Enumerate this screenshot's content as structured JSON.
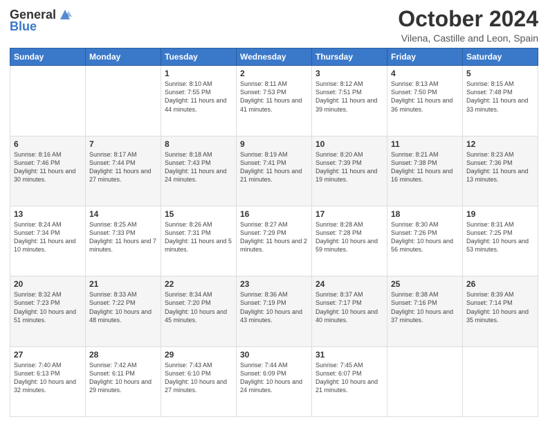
{
  "header": {
    "logo": {
      "general": "General",
      "blue": "Blue"
    },
    "title": "October 2024",
    "subtitle": "Vilena, Castille and Leon, Spain"
  },
  "calendar": {
    "days_of_week": [
      "Sunday",
      "Monday",
      "Tuesday",
      "Wednesday",
      "Thursday",
      "Friday",
      "Saturday"
    ],
    "weeks": [
      {
        "alt": false,
        "days": [
          {
            "num": "",
            "info": ""
          },
          {
            "num": "",
            "info": ""
          },
          {
            "num": "1",
            "info": "Sunrise: 8:10 AM\nSunset: 7:55 PM\nDaylight: 11 hours and 44 minutes."
          },
          {
            "num": "2",
            "info": "Sunrise: 8:11 AM\nSunset: 7:53 PM\nDaylight: 11 hours and 41 minutes."
          },
          {
            "num": "3",
            "info": "Sunrise: 8:12 AM\nSunset: 7:51 PM\nDaylight: 11 hours and 39 minutes."
          },
          {
            "num": "4",
            "info": "Sunrise: 8:13 AM\nSunset: 7:50 PM\nDaylight: 11 hours and 36 minutes."
          },
          {
            "num": "5",
            "info": "Sunrise: 8:15 AM\nSunset: 7:48 PM\nDaylight: 11 hours and 33 minutes."
          }
        ]
      },
      {
        "alt": true,
        "days": [
          {
            "num": "6",
            "info": "Sunrise: 8:16 AM\nSunset: 7:46 PM\nDaylight: 11 hours and 30 minutes."
          },
          {
            "num": "7",
            "info": "Sunrise: 8:17 AM\nSunset: 7:44 PM\nDaylight: 11 hours and 27 minutes."
          },
          {
            "num": "8",
            "info": "Sunrise: 8:18 AM\nSunset: 7:43 PM\nDaylight: 11 hours and 24 minutes."
          },
          {
            "num": "9",
            "info": "Sunrise: 8:19 AM\nSunset: 7:41 PM\nDaylight: 11 hours and 21 minutes."
          },
          {
            "num": "10",
            "info": "Sunrise: 8:20 AM\nSunset: 7:39 PM\nDaylight: 11 hours and 19 minutes."
          },
          {
            "num": "11",
            "info": "Sunrise: 8:21 AM\nSunset: 7:38 PM\nDaylight: 11 hours and 16 minutes."
          },
          {
            "num": "12",
            "info": "Sunrise: 8:23 AM\nSunset: 7:36 PM\nDaylight: 11 hours and 13 minutes."
          }
        ]
      },
      {
        "alt": false,
        "days": [
          {
            "num": "13",
            "info": "Sunrise: 8:24 AM\nSunset: 7:34 PM\nDaylight: 11 hours and 10 minutes."
          },
          {
            "num": "14",
            "info": "Sunrise: 8:25 AM\nSunset: 7:33 PM\nDaylight: 11 hours and 7 minutes."
          },
          {
            "num": "15",
            "info": "Sunrise: 8:26 AM\nSunset: 7:31 PM\nDaylight: 11 hours and 5 minutes."
          },
          {
            "num": "16",
            "info": "Sunrise: 8:27 AM\nSunset: 7:29 PM\nDaylight: 11 hours and 2 minutes."
          },
          {
            "num": "17",
            "info": "Sunrise: 8:28 AM\nSunset: 7:28 PM\nDaylight: 10 hours and 59 minutes."
          },
          {
            "num": "18",
            "info": "Sunrise: 8:30 AM\nSunset: 7:26 PM\nDaylight: 10 hours and 56 minutes."
          },
          {
            "num": "19",
            "info": "Sunrise: 8:31 AM\nSunset: 7:25 PM\nDaylight: 10 hours and 53 minutes."
          }
        ]
      },
      {
        "alt": true,
        "days": [
          {
            "num": "20",
            "info": "Sunrise: 8:32 AM\nSunset: 7:23 PM\nDaylight: 10 hours and 51 minutes."
          },
          {
            "num": "21",
            "info": "Sunrise: 8:33 AM\nSunset: 7:22 PM\nDaylight: 10 hours and 48 minutes."
          },
          {
            "num": "22",
            "info": "Sunrise: 8:34 AM\nSunset: 7:20 PM\nDaylight: 10 hours and 45 minutes."
          },
          {
            "num": "23",
            "info": "Sunrise: 8:36 AM\nSunset: 7:19 PM\nDaylight: 10 hours and 43 minutes."
          },
          {
            "num": "24",
            "info": "Sunrise: 8:37 AM\nSunset: 7:17 PM\nDaylight: 10 hours and 40 minutes."
          },
          {
            "num": "25",
            "info": "Sunrise: 8:38 AM\nSunset: 7:16 PM\nDaylight: 10 hours and 37 minutes."
          },
          {
            "num": "26",
            "info": "Sunrise: 8:39 AM\nSunset: 7:14 PM\nDaylight: 10 hours and 35 minutes."
          }
        ]
      },
      {
        "alt": false,
        "days": [
          {
            "num": "27",
            "info": "Sunrise: 7:40 AM\nSunset: 6:13 PM\nDaylight: 10 hours and 32 minutes."
          },
          {
            "num": "28",
            "info": "Sunrise: 7:42 AM\nSunset: 6:11 PM\nDaylight: 10 hours and 29 minutes."
          },
          {
            "num": "29",
            "info": "Sunrise: 7:43 AM\nSunset: 6:10 PM\nDaylight: 10 hours and 27 minutes."
          },
          {
            "num": "30",
            "info": "Sunrise: 7:44 AM\nSunset: 6:09 PM\nDaylight: 10 hours and 24 minutes."
          },
          {
            "num": "31",
            "info": "Sunrise: 7:45 AM\nSunset: 6:07 PM\nDaylight: 10 hours and 21 minutes."
          },
          {
            "num": "",
            "info": ""
          },
          {
            "num": "",
            "info": ""
          }
        ]
      }
    ]
  }
}
